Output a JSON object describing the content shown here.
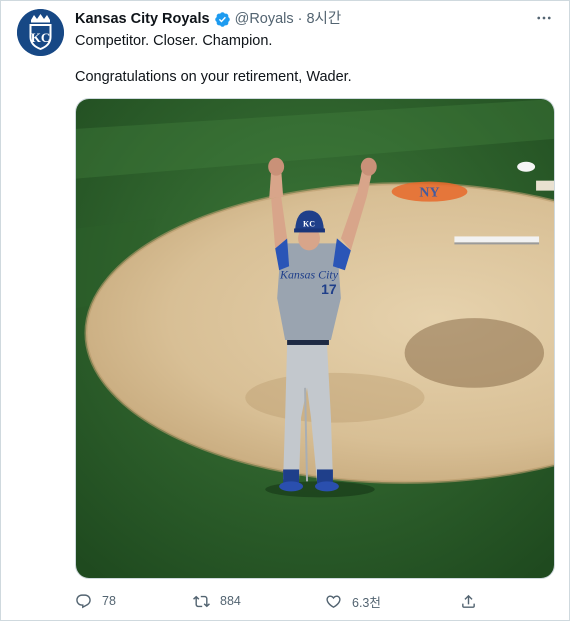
{
  "tweet": {
    "author": {
      "display_name": "Kansas City Royals",
      "handle": "@Royals",
      "avatar_icon": "royals-kc-logo-icon",
      "avatar_monogram": "KC",
      "verified_icon": "verified-badge-icon"
    },
    "separator": "·",
    "time": "8시간",
    "more_icon": "more-options-icon",
    "bio_line": "Competitor. Closer. Champion.",
    "text": "Congratulations on your retirement, Wader.",
    "media": {
      "kind": "photo",
      "subject": "pitcher-celebrating-on-mound",
      "jersey_number": "17"
    },
    "actions": {
      "reply": {
        "icon": "reply-icon",
        "count": "78"
      },
      "retweet": {
        "icon": "retweet-icon",
        "count": "884"
      },
      "like": {
        "icon": "heart-icon",
        "count": "6.3천"
      },
      "share": {
        "icon": "share-icon"
      }
    }
  },
  "colors": {
    "text": "#0f1419",
    "secondary_text": "#536471",
    "verified_blue": "#1d9bf0",
    "royals_blue": "#174885",
    "border": "#cfd9de"
  }
}
